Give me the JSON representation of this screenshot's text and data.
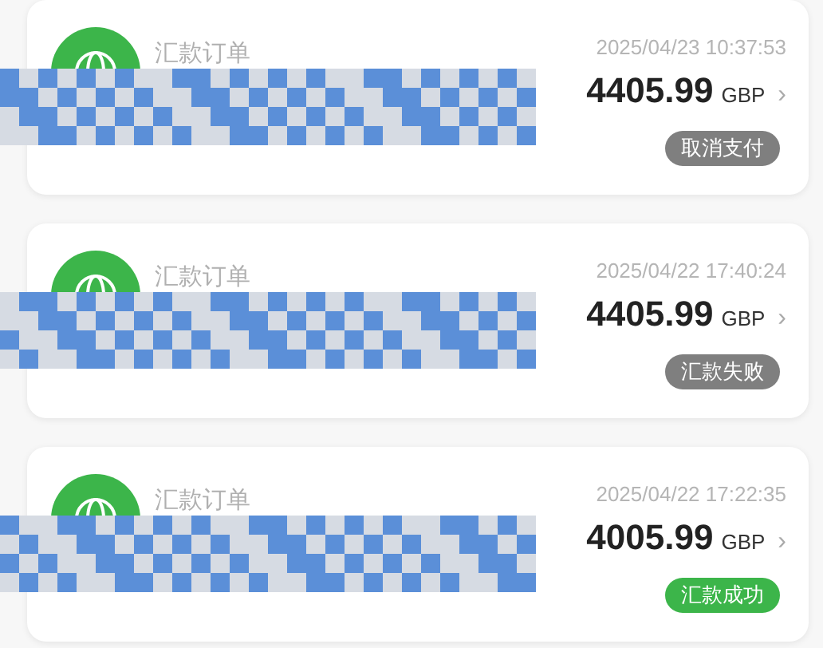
{
  "orders": [
    {
      "title": "汇款订单",
      "time": "2025/04/23 10:37:53",
      "amount": "4405.99",
      "currency": "GBP",
      "chevron": "›",
      "status": {
        "label": "取消支付",
        "color": "#7f7f7f"
      }
    },
    {
      "title": "汇款订单",
      "time": "2025/04/22 17:40:24",
      "amount": "4405.99",
      "currency": "GBP",
      "chevron": "›",
      "status": {
        "label": "汇款失败",
        "color": "#7f7f7f"
      }
    },
    {
      "title": "汇款订单",
      "time": "2025/04/22 17:22:35",
      "amount": "4005.99",
      "currency": "GBP",
      "chevron": "›",
      "status": {
        "label": "汇款成功",
        "color": "#3cb54a"
      }
    }
  ]
}
